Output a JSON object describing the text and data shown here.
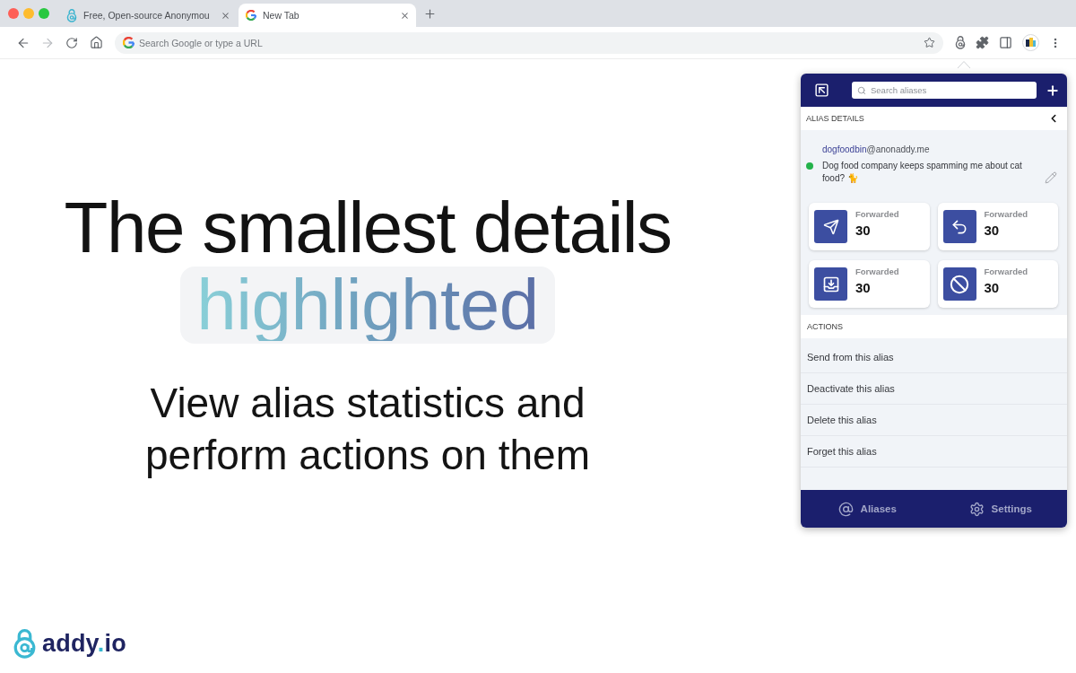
{
  "browser": {
    "tabs": [
      {
        "kind": "site",
        "title": "Free, Open-source Anonymou",
        "selected": false
      },
      {
        "kind": "new-tab",
        "title": "New Tab",
        "selected": true
      }
    ],
    "address_bar": {
      "placeholder": "Search Google or type a URL"
    }
  },
  "hero": {
    "heading": "The smallest details",
    "highlight": "highlighted",
    "subheading": "View alias statistics and perform actions on them"
  },
  "popup": {
    "search": {
      "placeholder": "Search aliases"
    },
    "details_title": "ALIAS DETAILS",
    "alias": {
      "local_part": "dogfoodbin",
      "domain": "@anonaddy.me",
      "active": true,
      "description": "Dog food company keeps spamming me about cat food? 🐈"
    },
    "stats": [
      {
        "kind": "sent",
        "label": "Forwarded",
        "value": "30"
      },
      {
        "kind": "replied",
        "label": "Forwarded",
        "value": "30"
      },
      {
        "kind": "received",
        "label": "Forwarded",
        "value": "30"
      },
      {
        "kind": "blocked",
        "label": "Forwarded",
        "value": "30"
      }
    ],
    "actions_title": "ACTIONS",
    "actions": [
      "Send from this alias",
      "Deactivate this alias",
      "Delete this alias",
      "Forget this alias"
    ],
    "nav": [
      {
        "kind": "aliases",
        "label": "Aliases"
      },
      {
        "kind": "settings",
        "label": "Settings"
      }
    ]
  },
  "logo": {
    "name": "addy",
    "separator": ".",
    "suffix": "io"
  }
}
